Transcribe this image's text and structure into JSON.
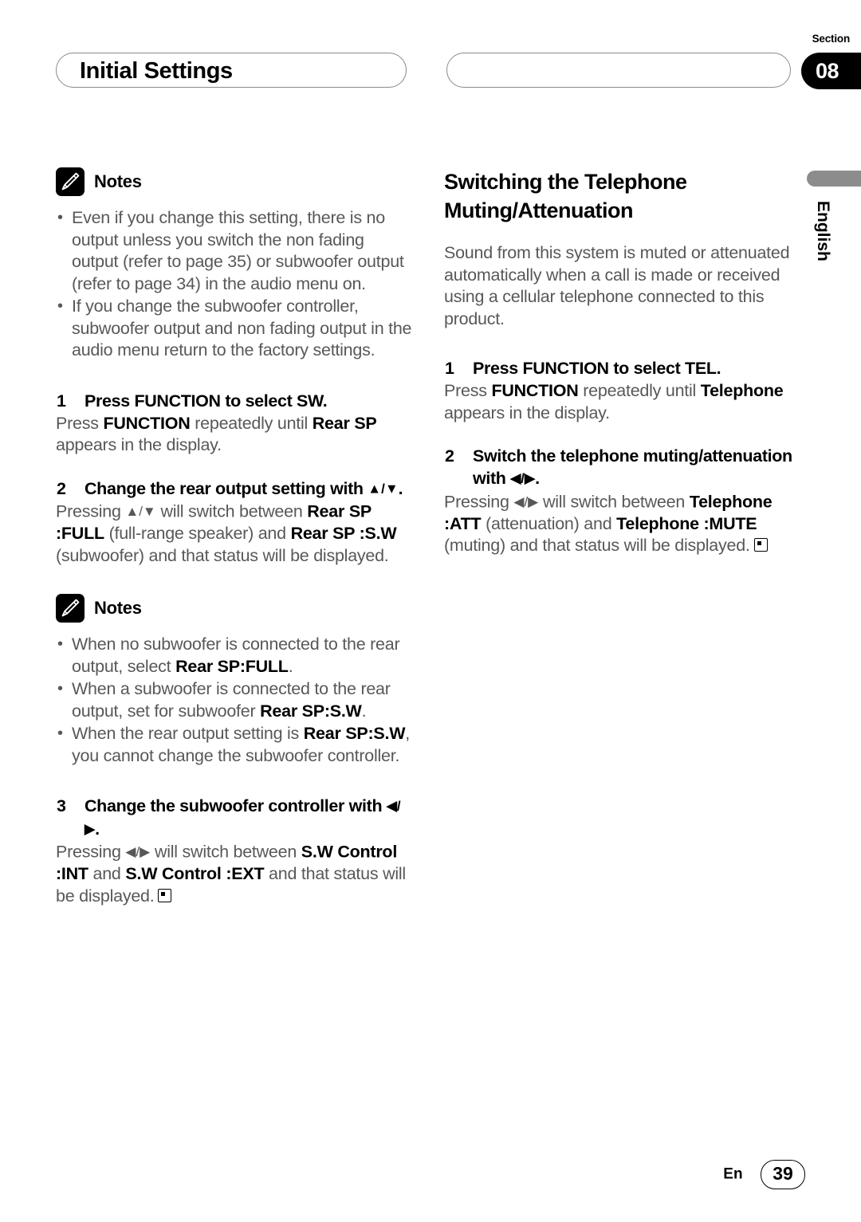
{
  "header": {
    "chapter_title": "Initial Settings",
    "section_label": "Section",
    "section_number": "08"
  },
  "side_tab": {
    "language": "English"
  },
  "left_column": {
    "notes_1": {
      "icon": "pencil-icon",
      "label": "Notes",
      "items": [
        "Even if you change this setting, there is no output unless you switch the non fading output (refer to page 35) or subwoofer output (refer to page 34) in the audio menu on.",
        "If you change the subwoofer controller, subwoofer output and non fading output in the audio menu return to the factory settings."
      ]
    },
    "step_1": {
      "number": "1",
      "heading_pre": "Press ",
      "heading_kw": "FUNCTION",
      "heading_post": " to select SW.",
      "body_1": "Press ",
      "body_kw_1": "FUNCTION",
      "body_2": " repeatedly until ",
      "body_kw_2": "Rear SP",
      "body_3": " appears in the display."
    },
    "step_2": {
      "number": "2",
      "heading_pre": "Change the rear output setting with ",
      "heading_arrows": "▲/▼",
      "heading_post": ".",
      "body_1": "Pressing ",
      "body_arrows": "▲/▼",
      "body_2": " will switch between ",
      "body_kw_1": "Rear SP :FULL",
      "body_3": " (full-range speaker) and ",
      "body_kw_2": "Rear SP :S.W",
      "body_4": " (subwoofer) and that status will be displayed."
    },
    "notes_2": {
      "icon": "pencil-icon",
      "label": "Notes",
      "items": [
        {
          "pre": "When no subwoofer is connected to the rear output, select ",
          "kw": "Rear SP:FULL",
          "post": "."
        },
        {
          "pre": "When a subwoofer is connected to the rear output, set for subwoofer ",
          "kw": "Rear SP:S.W",
          "post": "."
        },
        {
          "pre": "When the rear output setting is ",
          "kw": "Rear SP:S.W",
          "post": ", you cannot change the subwoofer controller."
        }
      ]
    },
    "step_3": {
      "number": "3",
      "heading_pre": "Change the subwoofer controller with ",
      "heading_arrows": "◀/▶",
      "heading_post": ".",
      "body_1": "Pressing ",
      "body_arrows": "◀/▶",
      "body_2": " will switch between ",
      "body_kw_1": "S.W Control :INT",
      "body_3": " and ",
      "body_kw_2": "S.W Control :EXT",
      "body_4": " and that status will be displayed.",
      "end_marker": "end-of-procedure-marker"
    }
  },
  "right_column": {
    "section_heading": "Switching the Telephone Muting/Attenuation",
    "intro": "Sound from this system is muted or attenuated automatically when a call is made or received using a cellular telephone connected to this product.",
    "step_1": {
      "number": "1",
      "heading_pre": "Press ",
      "heading_kw": "FUNCTION",
      "heading_post": " to select TEL.",
      "body_1": "Press ",
      "body_kw_1": "FUNCTION",
      "body_2": " repeatedly until ",
      "body_kw_2": "Telephone",
      "body_3": " appears in the display."
    },
    "step_2": {
      "number": "2",
      "heading_pre": "Switch the telephone muting/attenuation with ",
      "heading_arrows": "◀/▶",
      "heading_post": ".",
      "body_1": "Pressing ",
      "body_arrows": "◀/▶",
      "body_2": " will switch between ",
      "body_kw_1": "Telephone :ATT",
      "body_3": " (attenuation) and ",
      "body_kw_2": "Telephone :MUTE",
      "body_4": " (muting) and that status will be displayed.",
      "end_marker": "end-of-procedure-marker"
    }
  },
  "footer": {
    "language_code": "En",
    "page_number": "39"
  }
}
